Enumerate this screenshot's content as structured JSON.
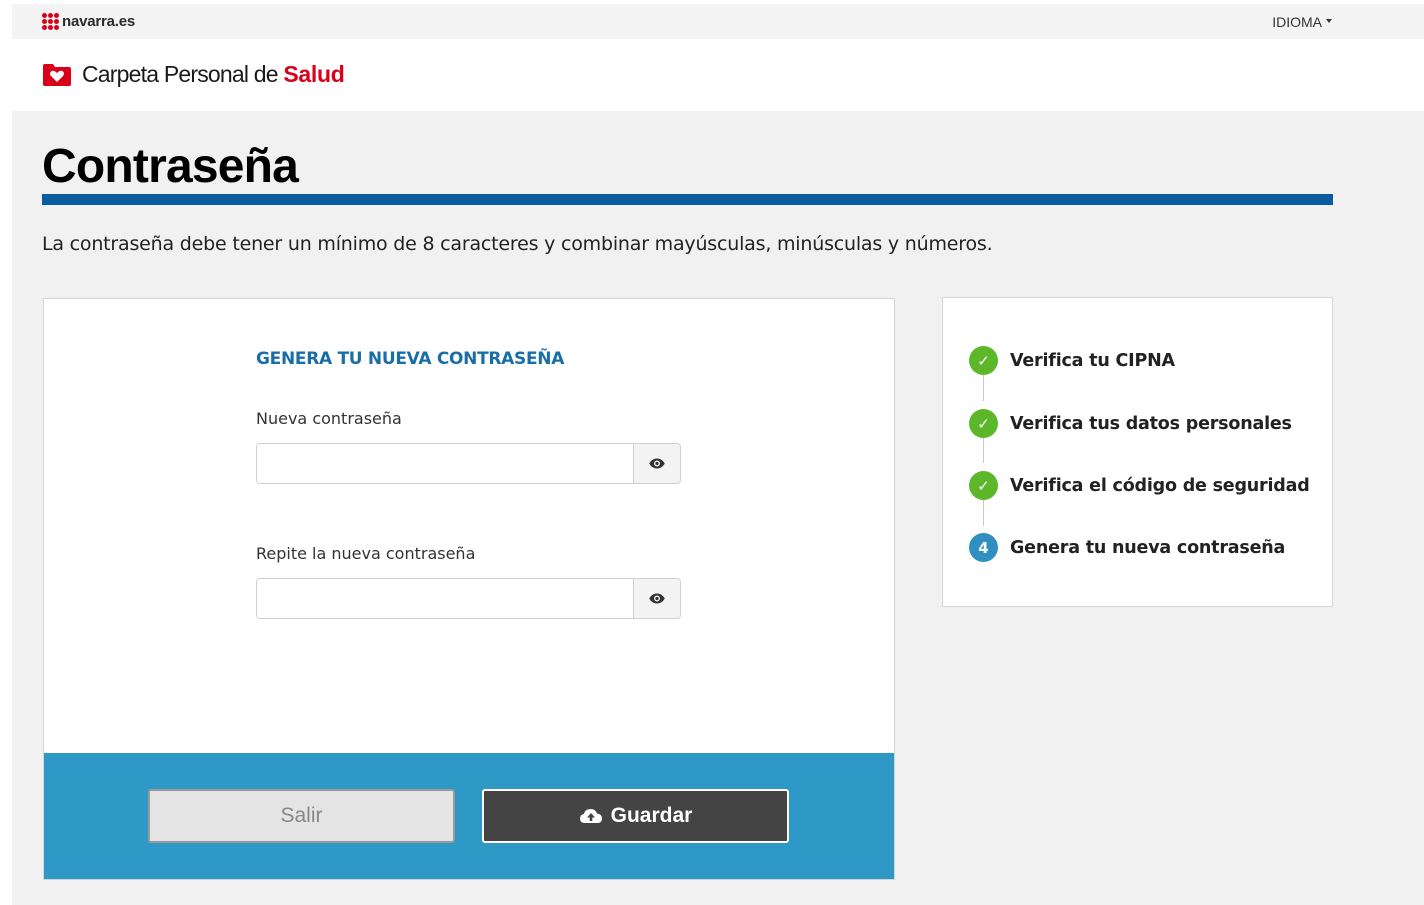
{
  "topbar": {
    "brand": "navarra.es",
    "language_label": "IDIOMA"
  },
  "app": {
    "title_prefix": "Carpeta Personal de ",
    "title_accent": "Salud"
  },
  "page": {
    "title": "Contraseña",
    "intro": "La contraseña debe tener un mínimo de 8 caracteres y combinar mayúsculas, minúsculas y números."
  },
  "form": {
    "heading": "GENERA TU NUEVA CONTRASEÑA",
    "new_password_label": "Nueva contraseña",
    "new_password_value": "",
    "repeat_password_label": "Repite la nueva contraseña",
    "repeat_password_value": "",
    "exit_label": "Salir",
    "save_label": "Guardar"
  },
  "steps": [
    {
      "label": "Verifica tu CIPNA",
      "status": "done"
    },
    {
      "label": "Verifica tus datos personales",
      "status": "done"
    },
    {
      "label": "Verifica el código de seguridad",
      "status": "done"
    },
    {
      "label": "Genera tu nueva contraseña",
      "status": "current",
      "number": "4"
    }
  ],
  "colors": {
    "brand_red": "#d9001a",
    "title_rule": "#0a5c9e",
    "heading_blue": "#1a6ea8",
    "action_bar": "#2e99c7",
    "step_done": "#5cb82a",
    "step_current": "#2e8fc0"
  },
  "icons": {
    "brand": "navarra-dots-icon",
    "app": "folder-heart-icon",
    "toggle": "eye-icon",
    "save": "cloud-upload-icon",
    "done": "check-icon"
  }
}
